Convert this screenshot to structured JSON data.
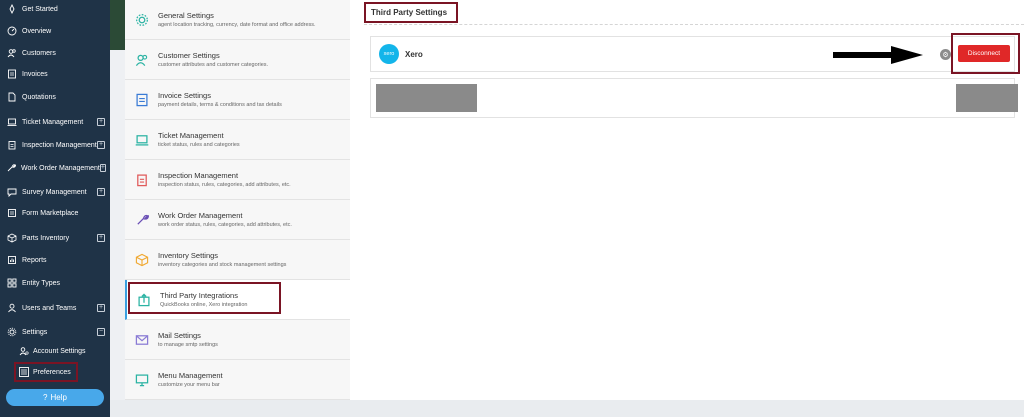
{
  "sidebar": {
    "items": [
      {
        "label": "Get Started",
        "icon": "rocket-icon",
        "expand": false
      },
      {
        "label": "Overview",
        "icon": "dashboard-icon",
        "expand": false
      },
      {
        "label": "Customers",
        "icon": "users-icon",
        "expand": false
      },
      {
        "label": "Invoices",
        "icon": "invoice-icon",
        "expand": false
      },
      {
        "label": "Quotations",
        "icon": "quote-icon",
        "expand": false
      },
      {
        "label": "Ticket Management",
        "icon": "laptop-icon",
        "expand": true
      },
      {
        "label": "Inspection Management",
        "icon": "clipboard-icon",
        "expand": true
      },
      {
        "label": "Work Order Management",
        "icon": "wrench-icon",
        "expand": true
      },
      {
        "label": "Survey Management",
        "icon": "chat-icon",
        "expand": true
      },
      {
        "label": "Form Marketplace",
        "icon": "form-icon",
        "expand": false
      },
      {
        "label": "Parts Inventory",
        "icon": "box-icon",
        "expand": true
      },
      {
        "label": "Reports",
        "icon": "chart-icon",
        "expand": false
      },
      {
        "label": "Entity Types",
        "icon": "grid-icon",
        "expand": false
      },
      {
        "label": "Users and Teams",
        "icon": "user-icon",
        "expand": true
      },
      {
        "label": "Settings",
        "icon": "gear-icon",
        "expand": true
      }
    ],
    "expand_symbol": "+",
    "collapse_symbol": "−",
    "sub_items": [
      {
        "label": "Account Settings",
        "icon": "account-icon"
      },
      {
        "label": "Preferences",
        "icon": "sliders-icon"
      }
    ],
    "help_label": "Help"
  },
  "settings_list": [
    {
      "title": "General Settings",
      "desc": "agent location tracking, currency, date format and office address.",
      "icon": "gear-icon",
      "color": "#2bb3a3"
    },
    {
      "title": "Customer Settings",
      "desc": "customer attributes and customer categories.",
      "icon": "users-icon",
      "color": "#2bb3a3"
    },
    {
      "title": "Invoice Settings",
      "desc": "payment details, terms & conditions and tax details",
      "icon": "invoice-icon",
      "color": "#3a7bd5"
    },
    {
      "title": "Ticket Management",
      "desc": "ticket status, rules and categories",
      "icon": "laptop-icon",
      "color": "#2bb3a3"
    },
    {
      "title": "Inspection Management",
      "desc": "inspection status, rules, categories, add attributes, etc.",
      "icon": "clipboard-icon",
      "color": "#e05a5a"
    },
    {
      "title": "Work Order Management",
      "desc": "work order status, rules, categories, add attributes, etc.",
      "icon": "wrench-icon",
      "color": "#6a4fb5"
    },
    {
      "title": "Inventory Settings",
      "desc": "inventory categories and stock management settings",
      "icon": "box-icon",
      "color": "#f0a830"
    },
    {
      "title": "Third Party Integrations",
      "desc": "QuickBooks online, Xero integration",
      "icon": "upload-icon",
      "color": "#2bb3a3"
    },
    {
      "title": "Mail Settings",
      "desc": "to manage smtp settings",
      "icon": "mail-icon",
      "color": "#8a7bd5"
    },
    {
      "title": "Menu Management",
      "desc": "customize your menu bar",
      "icon": "monitor-icon",
      "color": "#2bb3a3"
    }
  ],
  "main": {
    "title": "Third Party Settings",
    "integration": {
      "name": "Xero",
      "logo_text": "xero",
      "button_label": "Disconnect",
      "accent": "#13b5ea",
      "button_color": "#e02828"
    }
  }
}
